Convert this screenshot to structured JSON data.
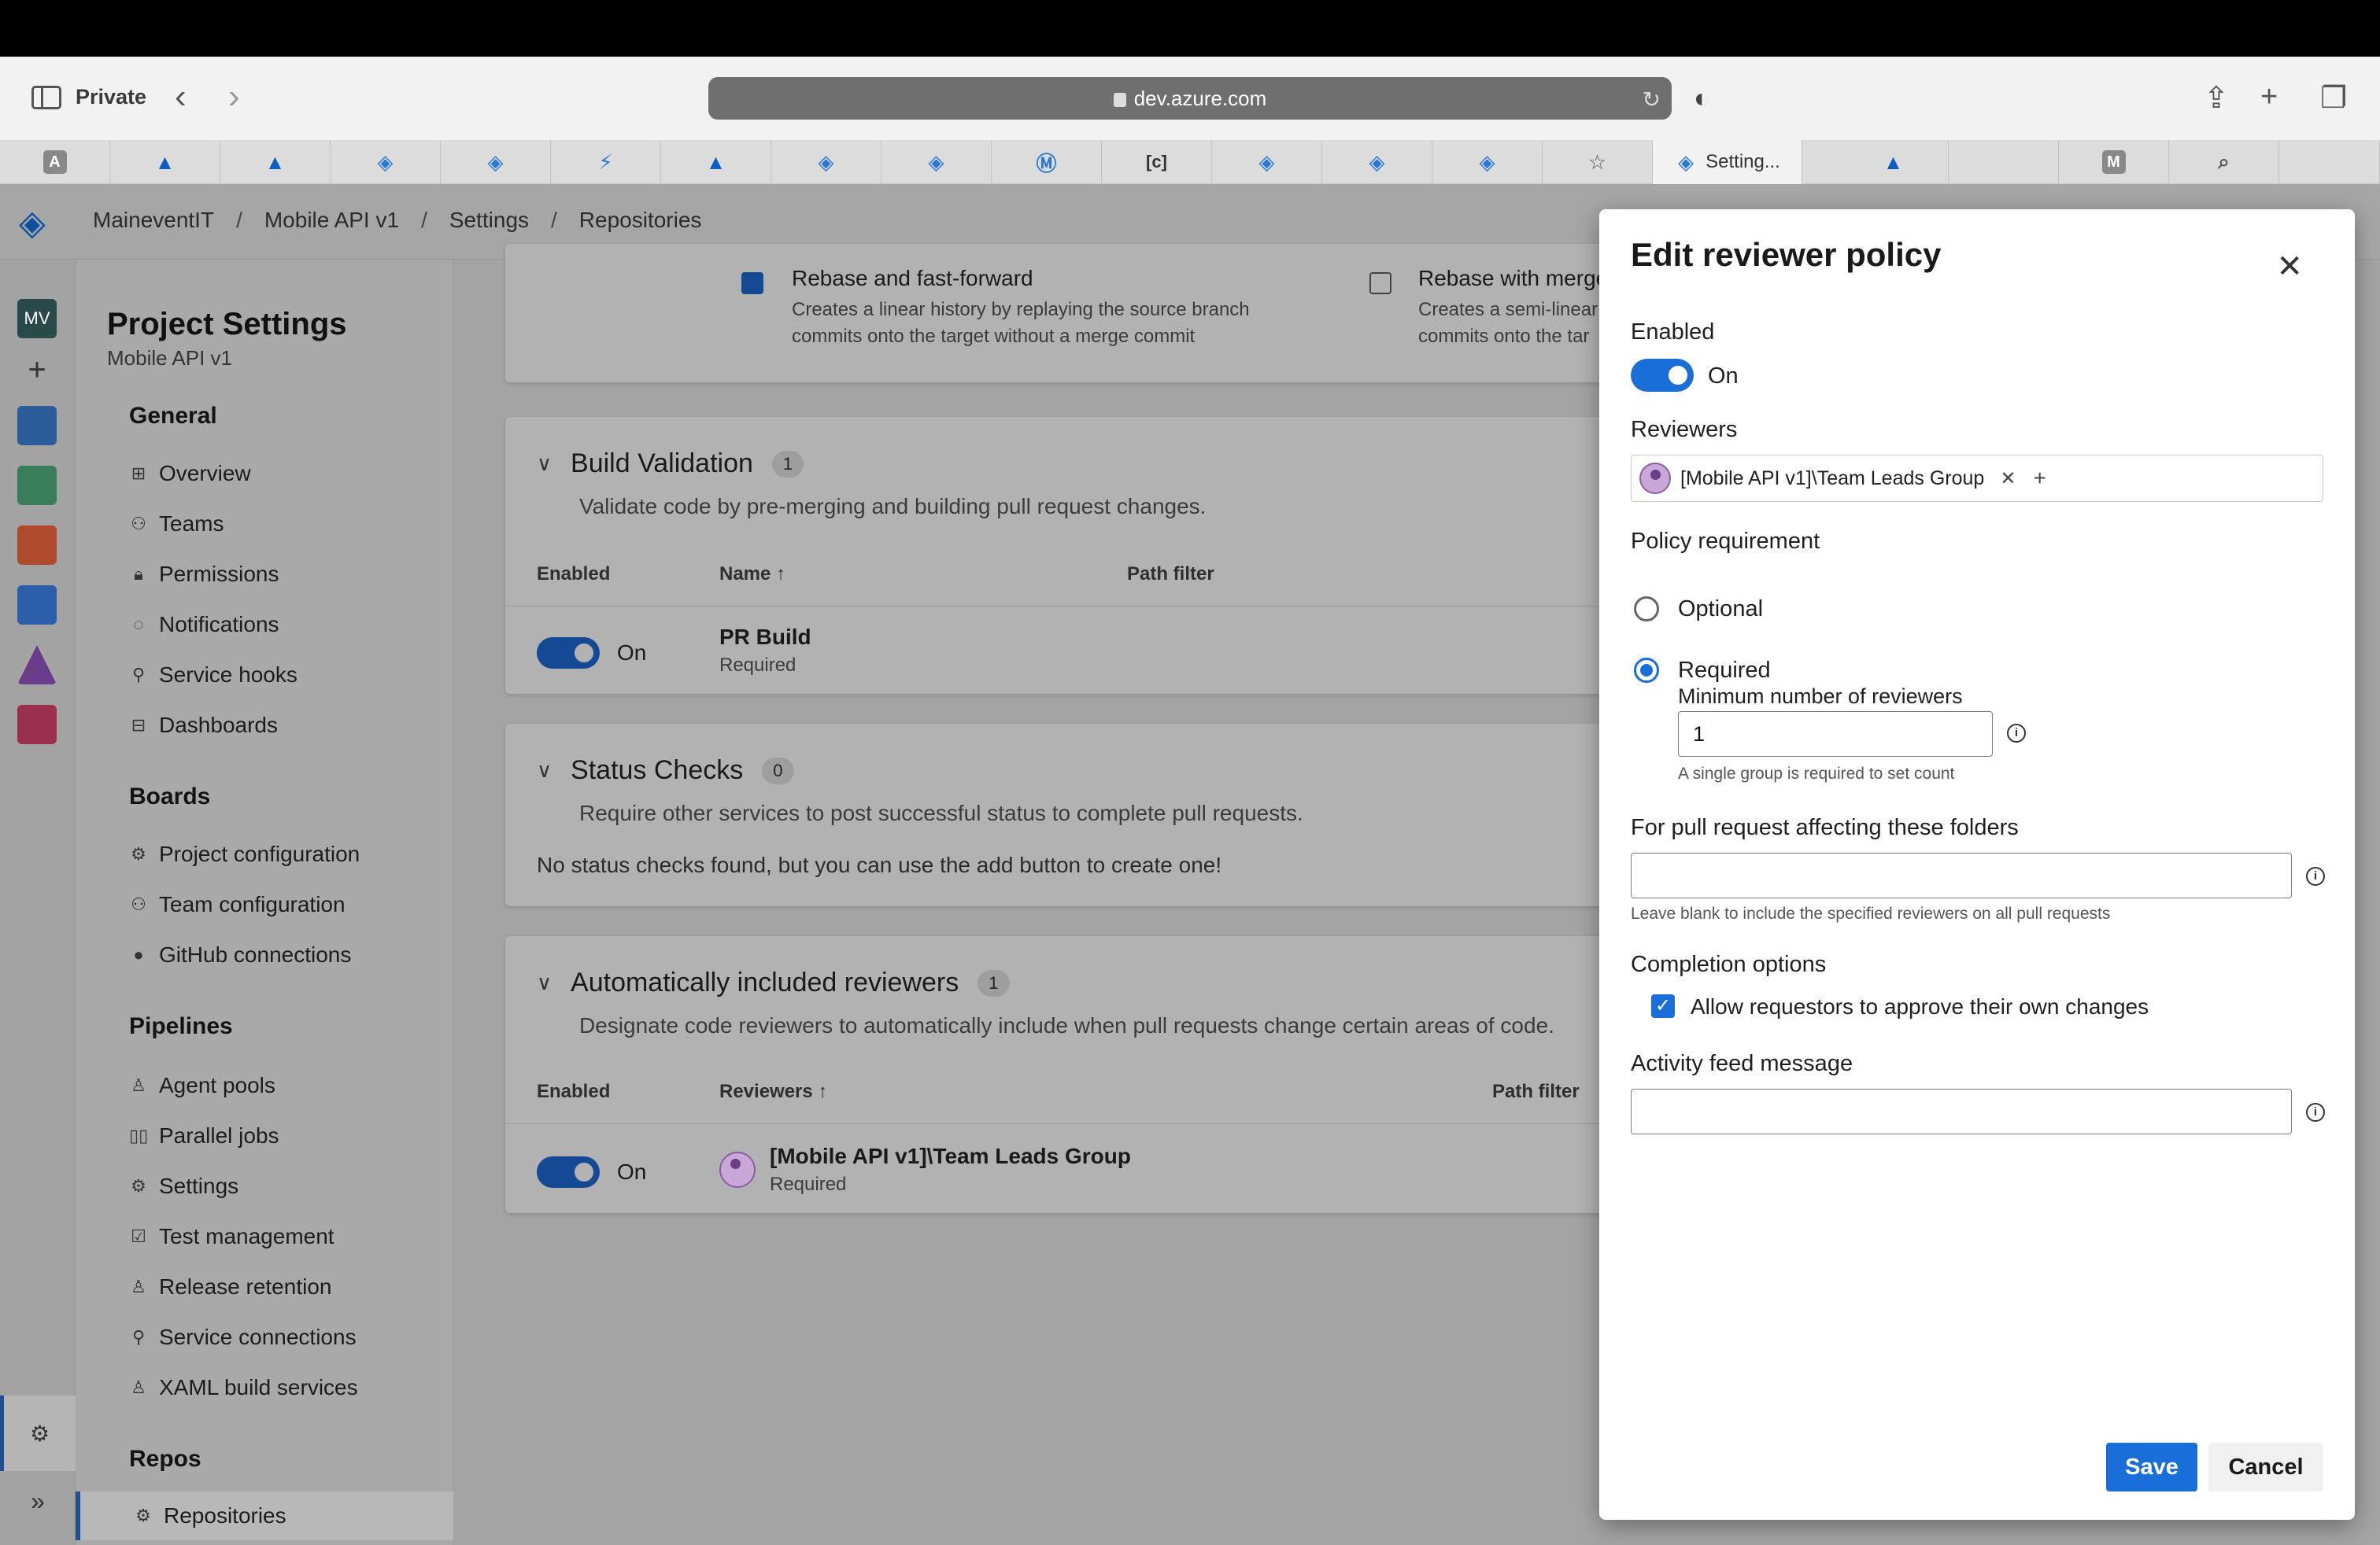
{
  "browser": {
    "mode": "Private",
    "url": "dev.azure.com",
    "active_tab_title": "Setting..."
  },
  "breadcrumb": [
    "MaineventIT",
    "Mobile API v1",
    "Settings",
    "Repositories"
  ],
  "rail": {
    "avatar_initials": "MV"
  },
  "nav": {
    "title": "Project Settings",
    "subtitle": "Mobile API v1",
    "sections": {
      "general": "General",
      "boards": "Boards",
      "pipelines": "Pipelines",
      "repos": "Repos"
    },
    "general_items": [
      "Overview",
      "Teams",
      "Permissions",
      "Notifications",
      "Service hooks",
      "Dashboards"
    ],
    "boards_items": [
      "Project configuration",
      "Team configuration",
      "GitHub connections"
    ],
    "pipelines_items": [
      "Agent pools",
      "Parallel jobs",
      "Settings",
      "Test management",
      "Release retention",
      "Service connections",
      "XAML build services"
    ],
    "repos_items": [
      "Repositories"
    ]
  },
  "merge": {
    "option1_title": "Rebase and fast-forward",
    "option1_desc_1": "Creates a linear history by replaying the source branch",
    "option1_desc_2": "commits onto the target without a merge commit",
    "option2_title": "Rebase with merge",
    "option2_desc_1": "Creates a semi-linear",
    "option2_desc_2": "commits onto the tar"
  },
  "build_validation": {
    "title": "Build Validation",
    "count": "1",
    "desc": "Validate code by pre-merging and building pull request changes.",
    "col_enabled": "Enabled",
    "col_name": "Name",
    "col_path": "Path filter",
    "row_toggle": "On",
    "row_name": "PR Build",
    "row_status": "Required"
  },
  "status_checks": {
    "title": "Status Checks",
    "count": "0",
    "desc": "Require other services to post successful status to complete pull requests.",
    "empty": "No status checks found, but you can use the add button to create one!"
  },
  "auto_reviewers": {
    "title": "Automatically included reviewers",
    "count": "1",
    "desc": "Designate code reviewers to automatically include when pull requests change certain areas of code.",
    "col_enabled": "Enabled",
    "col_reviewers": "Reviewers",
    "col_path": "Path filter",
    "row_toggle": "On",
    "row_name": "[Mobile API v1]\\Team Leads Group",
    "row_status": "Required"
  },
  "panel": {
    "title": "Edit reviewer policy",
    "enabled_label": "Enabled",
    "enabled_value": "On",
    "reviewers_label": "Reviewers",
    "reviewer_chip": "[Mobile API v1]\\Team Leads Group",
    "policy_label": "Policy requirement",
    "optional_label": "Optional",
    "required_label": "Required",
    "min_reviewers_label": "Minimum number of reviewers",
    "min_reviewers_value": "1",
    "min_reviewers_hint": "A single group is required to set count",
    "folders_label": "For pull request affecting these folders",
    "folders_value": "",
    "folders_hint": "Leave blank to include the specified reviewers on all pull requests",
    "completion_label": "Completion options",
    "completion_checkbox": "Allow requestors to approve their own changes",
    "activity_label": "Activity feed message",
    "activity_value": "",
    "save": "Save",
    "cancel": "Cancel"
  },
  "colors": {
    "accent": "#1a6ed8",
    "overlay_toggle": "#134a93"
  }
}
